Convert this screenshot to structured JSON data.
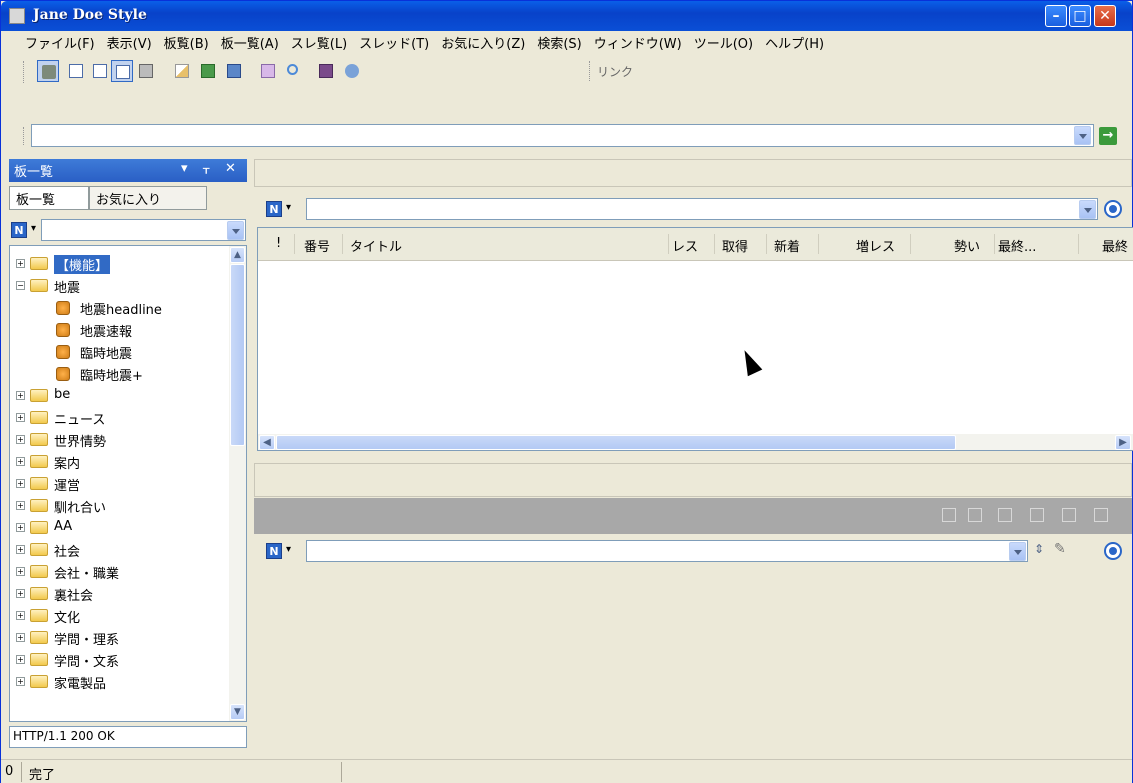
{
  "window": {
    "title": "Jane Doe Style"
  },
  "menu": [
    "ファイル(F)",
    "表示(V)",
    "板覧(B)",
    "板一覧(A)",
    "スレ覧(L)",
    "スレッド(T)",
    "お気に入り(Z)",
    "検索(S)",
    "ウィンドウ(W)",
    "ツール(O)",
    "ヘルプ(H)"
  ],
  "toolbar": {
    "link_label": "リンク"
  },
  "left_pane": {
    "title": "板一覧",
    "tabs": [
      "板一覧",
      "お気に入り"
    ],
    "tree": [
      {
        "label": "【機能】",
        "type": "folder",
        "expanded": false,
        "selected": true
      },
      {
        "label": "地震",
        "type": "folder",
        "expanded": true
      },
      {
        "label": "地震headline",
        "type": "board"
      },
      {
        "label": "地震速報",
        "type": "board"
      },
      {
        "label": "臨時地震",
        "type": "board"
      },
      {
        "label": "臨時地震+",
        "type": "board"
      },
      {
        "label": "be",
        "type": "folder",
        "expanded": false
      },
      {
        "label": "ニュース",
        "type": "folder",
        "expanded": false
      },
      {
        "label": "世界情勢",
        "type": "folder",
        "expanded": false
      },
      {
        "label": "案内",
        "type": "folder",
        "expanded": false
      },
      {
        "label": "運営",
        "type": "folder",
        "expanded": false
      },
      {
        "label": "馴れ合い",
        "type": "folder",
        "expanded": false
      },
      {
        "label": "AA",
        "type": "folder",
        "expanded": false
      },
      {
        "label": "社会",
        "type": "folder",
        "expanded": false
      },
      {
        "label": "会社・職業",
        "type": "folder",
        "expanded": false
      },
      {
        "label": "裏社会",
        "type": "folder",
        "expanded": false
      },
      {
        "label": "文化",
        "type": "folder",
        "expanded": false
      },
      {
        "label": "学問・理系",
        "type": "folder",
        "expanded": false
      },
      {
        "label": "学問・文系",
        "type": "folder",
        "expanded": false
      },
      {
        "label": "家電製品",
        "type": "folder",
        "expanded": false
      }
    ],
    "status": "HTTP/1.1 200 OK"
  },
  "thread_list": {
    "columns": [
      "!",
      "番号",
      "タイトル",
      "レス",
      "取得",
      "新着",
      "増レス",
      "勢い",
      "最終...",
      "最終"
    ]
  },
  "statusbar": {
    "count": "0",
    "text": "完了"
  },
  "icons": {
    "n_button": "N"
  }
}
